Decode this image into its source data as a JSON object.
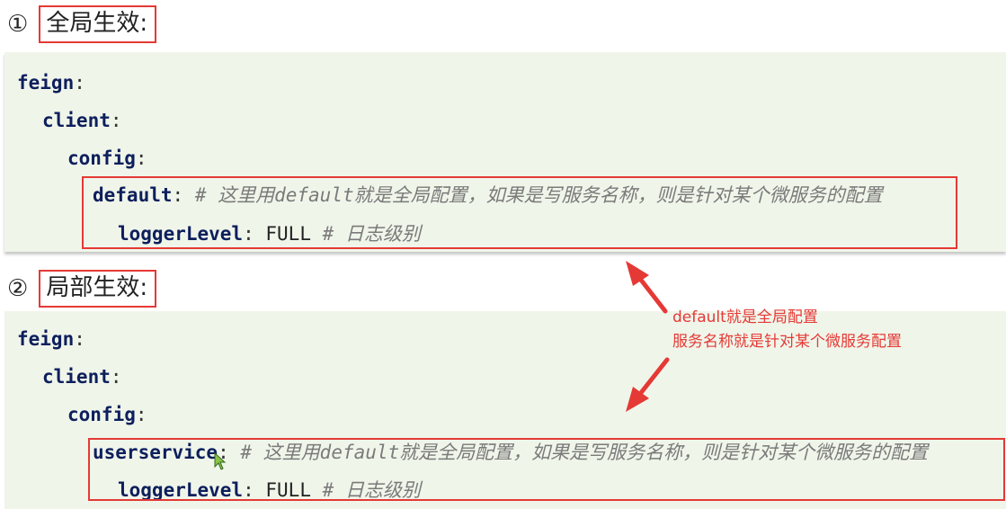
{
  "section1": {
    "number": "①",
    "title": "全局生效:",
    "code": {
      "l1_key": "feign",
      "l1_colon": ":",
      "l2_key": "client",
      "l2_colon": ":",
      "l3_key": "config",
      "l3_colon": ":",
      "l4_key": "default",
      "l4_colon": ":",
      "l4_comment": "# 这里用default就是全局配置，如果是写服务名称，则是针对某个微服务的配置",
      "l5_key": "loggerLevel",
      "l5_colon": ":",
      "l5_value": "FULL",
      "l5_comment": "# 日志级别"
    }
  },
  "section2": {
    "number": "②",
    "title": "局部生效:",
    "code": {
      "l1_key": "feign",
      "l1_colon": ":",
      "l2_key": "client",
      "l2_colon": ":",
      "l3_key": "config",
      "l3_colon": ":",
      "l4_key": "userservice",
      "l4_colon": ":",
      "l4_comment": "# 这里用default就是全局配置，如果是写服务名称，则是针对某个微服务的配置",
      "l5_key": "loggerLevel",
      "l5_colon": ":",
      "l5_value": "FULL",
      "l5_comment": "# 日志级别"
    }
  },
  "annotation": {
    "line1": "default就是全局配置",
    "line2": "服务名称就是针对某个微服务配置"
  },
  "colors": {
    "highlight": "#e53935",
    "code_background": "#f0f5ea",
    "keyword": "#0d1f5c",
    "comment": "#7a7a7a"
  },
  "icons": [
    "arrow-up-icon",
    "arrow-down-icon",
    "mouse-cursor-icon"
  ]
}
